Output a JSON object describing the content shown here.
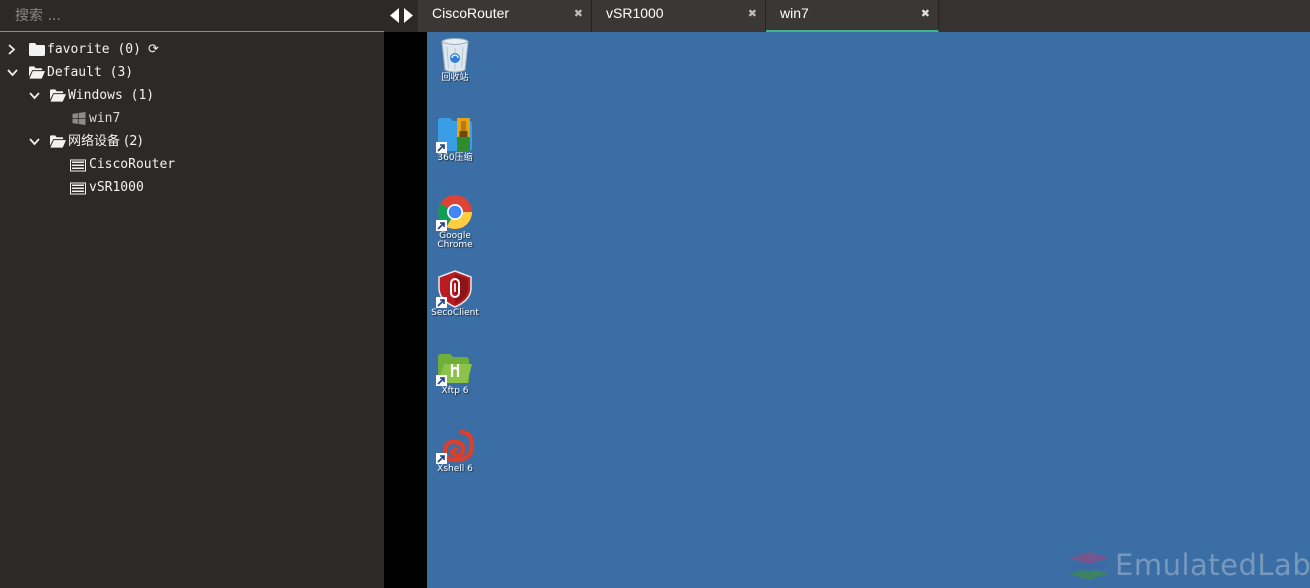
{
  "search": {
    "placeholder": "搜索 ..."
  },
  "tree": {
    "favorite": {
      "label": "favorite (0)"
    },
    "default": {
      "label": "Default (3)"
    },
    "windows": {
      "label": "Windows (1)"
    },
    "win7": {
      "label": "win7"
    },
    "network": {
      "label": "网络设备 (2)"
    },
    "cisco": {
      "label": "CiscoRouter"
    },
    "vsr": {
      "label": "vSR1000"
    }
  },
  "tabs": [
    {
      "label": "CiscoRouter",
      "close": "✖",
      "active": false
    },
    {
      "label": "vSR1000",
      "close": "✖",
      "active": false
    },
    {
      "label": "win7",
      "close": "✖",
      "active": true
    }
  ],
  "desktop_icons": [
    {
      "label": "回收站",
      "icon": "recycle-bin-icon"
    },
    {
      "label": "360压缩",
      "icon": "archive-icon"
    },
    {
      "label": "Google\nChrome",
      "icon": "chrome-icon"
    },
    {
      "label": "SecoClient",
      "icon": "seco-shield-icon"
    },
    {
      "label": "Xftp 6",
      "icon": "xftp-icon"
    },
    {
      "label": "Xshell 6",
      "icon": "xshell-icon"
    }
  ],
  "watermark": {
    "text": "EmulatedLab"
  },
  "colors": {
    "accent": "#3fb38a",
    "desktop": "#3a6ea5",
    "panel": "#2b2a28"
  }
}
